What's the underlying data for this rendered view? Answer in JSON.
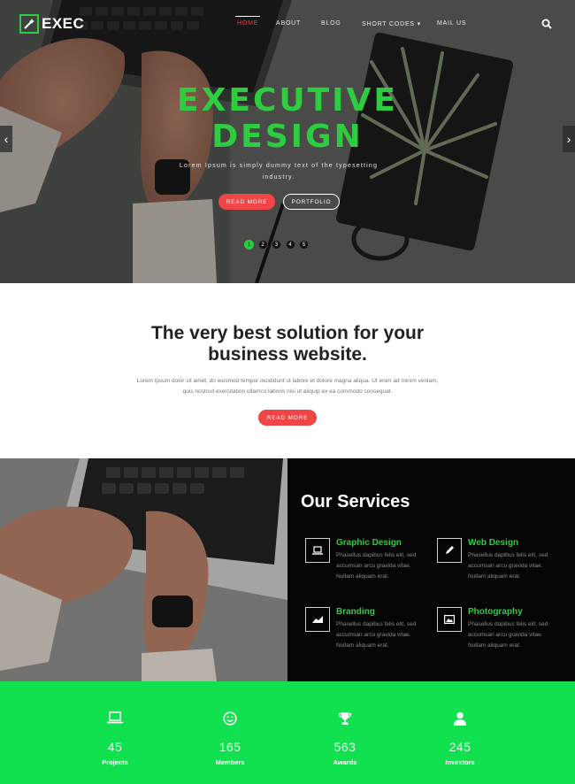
{
  "brand": {
    "name": "EXEC",
    "accent": "#2ecc40",
    "red": "#f14444",
    "stats_bg": "#11e04f"
  },
  "nav": {
    "items": [
      {
        "label": "Home",
        "active": true
      },
      {
        "label": "About"
      },
      {
        "label": "Blog"
      },
      {
        "label": "Short Codes ▾"
      },
      {
        "label": "Mail Us"
      }
    ],
    "search_icon": "search-icon"
  },
  "hero": {
    "title_line1": "EXECUTIVE",
    "title_line2": "DESIGN",
    "subtitle": "Lorem Ipsum is simply dummy text of the typesetting industry.",
    "read_more": "Read More",
    "portfolio": "Portfolio",
    "slides": [
      "1",
      "2",
      "3",
      "4",
      "5"
    ],
    "active_slide": 1,
    "prev_arrow": "‹",
    "next_arrow": "›"
  },
  "intro": {
    "title_line1": "The very best solution for your",
    "title_line2": "business website.",
    "text_line1": "Lorem ipsum dolor sit amet, do eiusmod tempor incididunt ut labore et dolore magna aliqua. Ut enim ad minim veniam,",
    "text_line2": "quis nostrud exercitation ullamco laboris nisi ut aliquip ex ea commodo consequat.",
    "read_more": "Read More"
  },
  "services": {
    "title": "Our Services",
    "items": [
      {
        "name": "Graphic Design",
        "icon": "laptop-icon",
        "desc": "Phasellus dapibus felis elit, sed accumsan arcu gravida vitae. Nullam aliquam erat."
      },
      {
        "name": "Web Design",
        "icon": "pencil-icon",
        "desc": "Phasellus dapibus felis elit, sed accumsan arcu gravida vitae. Nullam aliquam erat."
      },
      {
        "name": "Branding",
        "icon": "chart-icon",
        "desc": "Phasellus dapibus felis elit, sed accumsan arcu gravida vitae. Nullam aliquam erat."
      },
      {
        "name": "Photography",
        "icon": "image-icon",
        "desc": "Phasellus dapibus felis elit, sed accumsan arcu gravida vitae. Nullam aliquam erat."
      }
    ]
  },
  "stats": [
    {
      "value": "45",
      "label": "Projects",
      "icon": "laptop-icon"
    },
    {
      "value": "165",
      "label": "Members",
      "icon": "smile-icon"
    },
    {
      "value": "563",
      "label": "Awards",
      "icon": "trophy-icon"
    },
    {
      "value": "245",
      "label": "Investors",
      "icon": "user-icon"
    }
  ]
}
